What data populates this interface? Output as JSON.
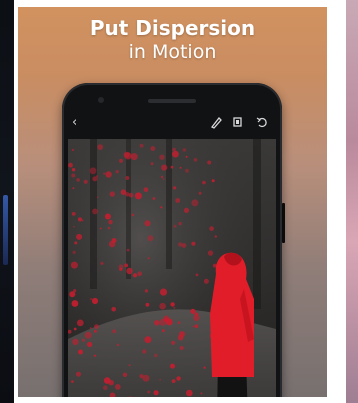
{
  "headline": {
    "line1": "Put Dispersion",
    "line2": "in Motion"
  },
  "toolbar": {
    "back_glyph": "‹",
    "icons": [
      "brush-icon",
      "layers-icon",
      "undo-icon"
    ]
  },
  "colors": {
    "banner_top": "#d2925f",
    "banner_bottom": "#77706f",
    "jacket_red": "#e11d2a",
    "particle_red": "#c41e2f"
  }
}
